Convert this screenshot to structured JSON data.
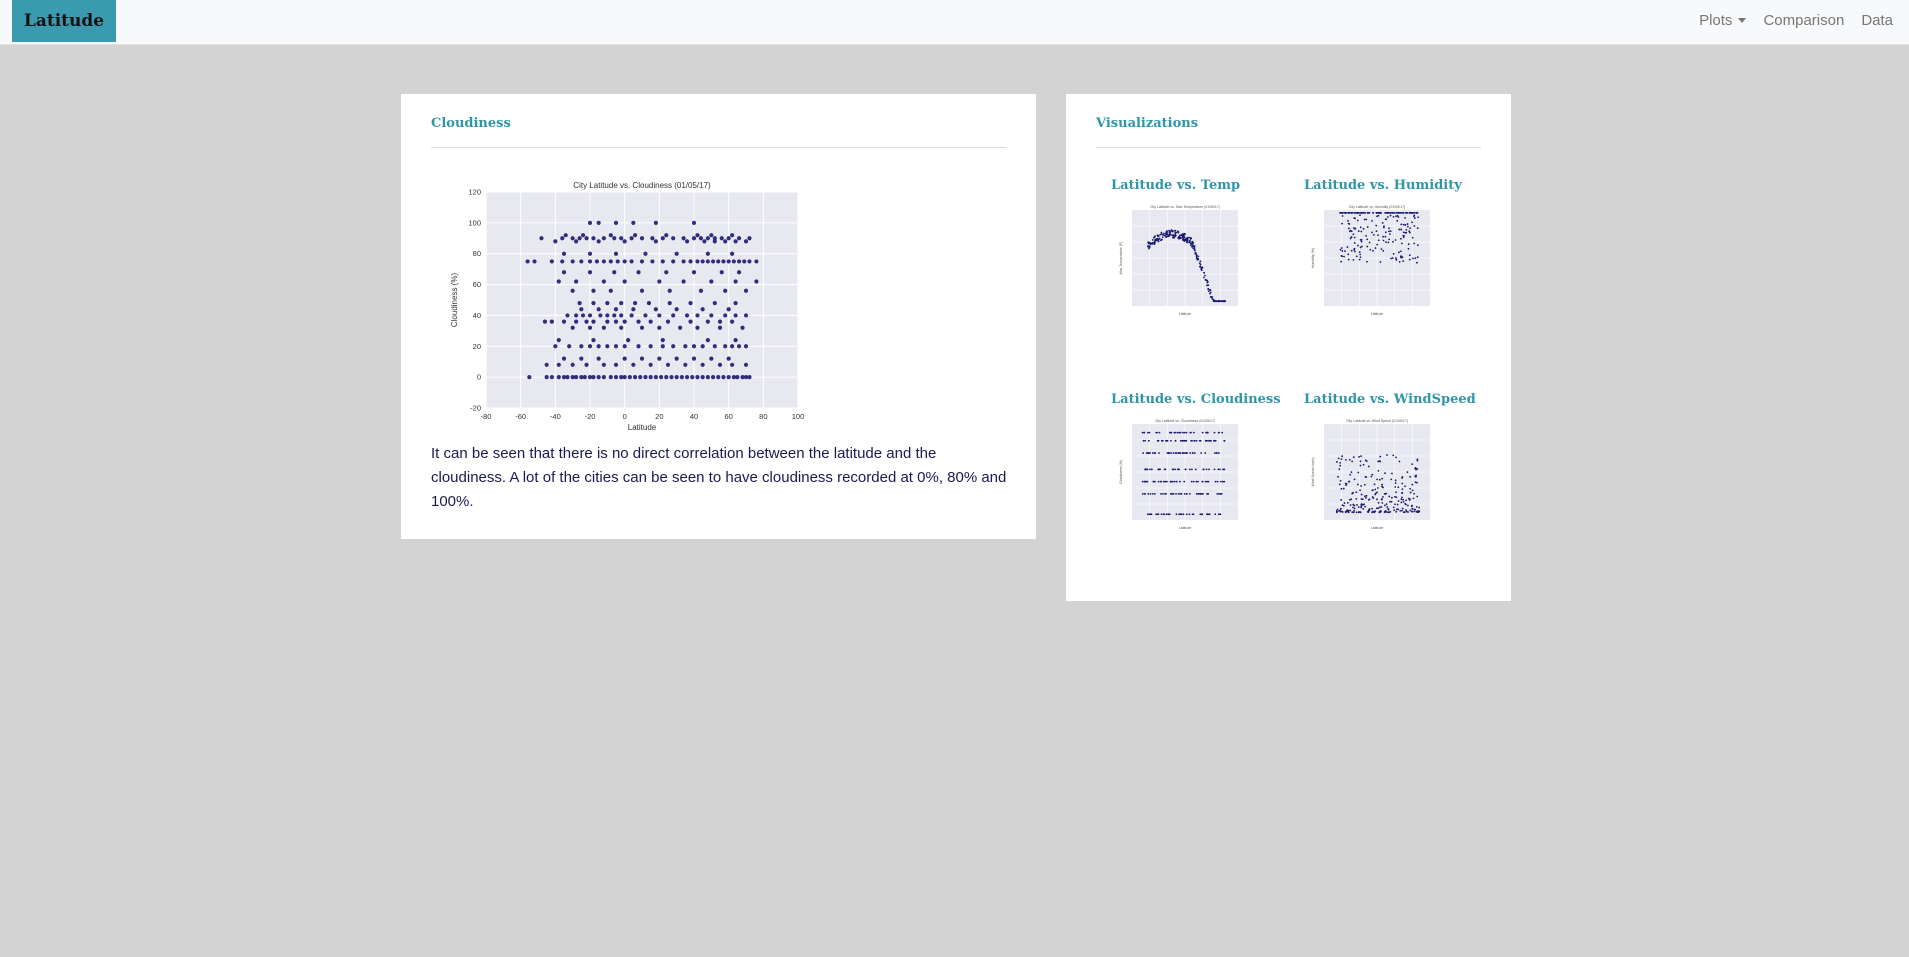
{
  "navbar": {
    "brand": "Latitude",
    "links": [
      {
        "label": "Plots",
        "dropdown": true
      },
      {
        "label": "Comparison"
      },
      {
        "label": "Data"
      }
    ]
  },
  "main_panel": {
    "title": "Cloudiness",
    "description": "It can be seen that there is no direct correlation between the latitude and the cloudiness. A lot of the cities can be seen to have cloudiness recorded at 0%, 80% and 100%."
  },
  "viz_panel": {
    "title": "Visualizations",
    "thumbnails": [
      {
        "title": "Latitude vs. Temp"
      },
      {
        "title": "Latitude vs. Humidity"
      },
      {
        "title": "Latitude vs. Cloudiness"
      },
      {
        "title": "Latitude vs. WindSpeed"
      }
    ]
  },
  "chart_data": {
    "type": "scatter",
    "title": "City Latitude vs. Cloudiness (01/05/17)",
    "xlabel": "Latitude",
    "ylabel": "Cloudiness (%)",
    "xlim": [
      -80,
      100
    ],
    "ylim": [
      -20,
      120
    ],
    "xticks": [
      -80,
      -60,
      -40,
      -20,
      0,
      20,
      40,
      60,
      80,
      100
    ],
    "yticks": [
      -20,
      0,
      20,
      40,
      60,
      80,
      100,
      120
    ],
    "grid": true,
    "point_color": "#191970",
    "background": "#e8e8f1",
    "points": [
      [
        -55,
        0
      ],
      [
        -45,
        0
      ],
      [
        -42,
        0
      ],
      [
        -38,
        0
      ],
      [
        -35,
        0
      ],
      [
        -33,
        0
      ],
      [
        -30,
        0
      ],
      [
        -28,
        0
      ],
      [
        -25,
        0
      ],
      [
        -23,
        0
      ],
      [
        -20,
        0
      ],
      [
        -18,
        0
      ],
      [
        -15,
        0
      ],
      [
        -12,
        0
      ],
      [
        -8,
        0
      ],
      [
        -5,
        0
      ],
      [
        -2,
        0
      ],
      [
        0,
        0
      ],
      [
        3,
        0
      ],
      [
        6,
        0
      ],
      [
        9,
        0
      ],
      [
        12,
        0
      ],
      [
        15,
        0
      ],
      [
        18,
        0
      ],
      [
        21,
        0
      ],
      [
        24,
        0
      ],
      [
        27,
        0
      ],
      [
        30,
        0
      ],
      [
        33,
        0
      ],
      [
        36,
        0
      ],
      [
        39,
        0
      ],
      [
        42,
        0
      ],
      [
        45,
        0
      ],
      [
        48,
        0
      ],
      [
        51,
        0
      ],
      [
        54,
        0
      ],
      [
        57,
        0
      ],
      [
        60,
        0
      ],
      [
        63,
        0
      ],
      [
        65,
        0
      ],
      [
        68,
        0
      ],
      [
        70,
        0
      ],
      [
        72,
        0
      ],
      [
        -45,
        8
      ],
      [
        -38,
        8
      ],
      [
        -30,
        8
      ],
      [
        -22,
        8
      ],
      [
        -12,
        8
      ],
      [
        -5,
        8
      ],
      [
        5,
        8
      ],
      [
        15,
        8
      ],
      [
        25,
        8
      ],
      [
        35,
        8
      ],
      [
        45,
        8
      ],
      [
        55,
        8
      ],
      [
        62,
        8
      ],
      [
        70,
        8
      ],
      [
        -35,
        12
      ],
      [
        -25,
        12
      ],
      [
        -15,
        12
      ],
      [
        0,
        12
      ],
      [
        10,
        12
      ],
      [
        20,
        12
      ],
      [
        30,
        12
      ],
      [
        40,
        12
      ],
      [
        50,
        12
      ],
      [
        60,
        12
      ],
      [
        -40,
        20
      ],
      [
        -32,
        20
      ],
      [
        -25,
        20
      ],
      [
        -20,
        20
      ],
      [
        -15,
        20
      ],
      [
        -10,
        20
      ],
      [
        -5,
        20
      ],
      [
        0,
        20
      ],
      [
        8,
        20
      ],
      [
        15,
        20
      ],
      [
        22,
        20
      ],
      [
        28,
        20
      ],
      [
        35,
        20
      ],
      [
        40,
        20
      ],
      [
        45,
        20
      ],
      [
        52,
        20
      ],
      [
        58,
        20
      ],
      [
        62,
        20
      ],
      [
        66,
        20
      ],
      [
        70,
        20
      ],
      [
        -38,
        24
      ],
      [
        -18,
        24
      ],
      [
        2,
        24
      ],
      [
        22,
        24
      ],
      [
        48,
        24
      ],
      [
        64,
        24
      ],
      [
        -30,
        32
      ],
      [
        -20,
        32
      ],
      [
        -12,
        32
      ],
      [
        -2,
        32
      ],
      [
        10,
        32
      ],
      [
        20,
        32
      ],
      [
        32,
        32
      ],
      [
        42,
        32
      ],
      [
        55,
        32
      ],
      [
        68,
        32
      ],
      [
        -46,
        36
      ],
      [
        -42,
        36
      ],
      [
        -35,
        36
      ],
      [
        -28,
        36
      ],
      [
        -22,
        36
      ],
      [
        -18,
        36
      ],
      [
        -10,
        36
      ],
      [
        -5,
        36
      ],
      [
        0,
        36
      ],
      [
        8,
        36
      ],
      [
        15,
        36
      ],
      [
        25,
        36
      ],
      [
        38,
        36
      ],
      [
        48,
        36
      ],
      [
        55,
        36
      ],
      [
        62,
        36
      ],
      [
        -33,
        40
      ],
      [
        -28,
        40
      ],
      [
        -24,
        40
      ],
      [
        -20,
        40
      ],
      [
        -14,
        40
      ],
      [
        -10,
        40
      ],
      [
        -6,
        40
      ],
      [
        -2,
        40
      ],
      [
        4,
        40
      ],
      [
        12,
        40
      ],
      [
        20,
        40
      ],
      [
        28,
        40
      ],
      [
        36,
        40
      ],
      [
        42,
        40
      ],
      [
        50,
        40
      ],
      [
        58,
        40
      ],
      [
        64,
        40
      ],
      [
        70,
        40
      ],
      [
        -25,
        44
      ],
      [
        -15,
        44
      ],
      [
        -5,
        44
      ],
      [
        5,
        44
      ],
      [
        18,
        44
      ],
      [
        30,
        44
      ],
      [
        45,
        44
      ],
      [
        60,
        44
      ],
      [
        -26,
        48
      ],
      [
        -18,
        48
      ],
      [
        -10,
        48
      ],
      [
        -2,
        48
      ],
      [
        6,
        48
      ],
      [
        14,
        48
      ],
      [
        26,
        48
      ],
      [
        38,
        48
      ],
      [
        52,
        48
      ],
      [
        64,
        48
      ],
      [
        -30,
        56
      ],
      [
        -18,
        56
      ],
      [
        -8,
        56
      ],
      [
        10,
        56
      ],
      [
        26,
        56
      ],
      [
        44,
        56
      ],
      [
        58,
        56
      ],
      [
        70,
        56
      ],
      [
        -38,
        62
      ],
      [
        -28,
        62
      ],
      [
        -12,
        62
      ],
      [
        0,
        62
      ],
      [
        20,
        62
      ],
      [
        34,
        62
      ],
      [
        50,
        62
      ],
      [
        64,
        62
      ],
      [
        76,
        62
      ],
      [
        -35,
        68
      ],
      [
        -20,
        68
      ],
      [
        -6,
        68
      ],
      [
        8,
        68
      ],
      [
        24,
        68
      ],
      [
        40,
        68
      ],
      [
        56,
        68
      ],
      [
        66,
        68
      ],
      [
        -56,
        75
      ],
      [
        -52,
        75
      ],
      [
        -42,
        75
      ],
      [
        -36,
        75
      ],
      [
        -30,
        75
      ],
      [
        -25,
        75
      ],
      [
        -20,
        75
      ],
      [
        -16,
        75
      ],
      [
        -12,
        75
      ],
      [
        -8,
        75
      ],
      [
        -4,
        75
      ],
      [
        0,
        75
      ],
      [
        4,
        75
      ],
      [
        10,
        75
      ],
      [
        16,
        75
      ],
      [
        22,
        75
      ],
      [
        28,
        75
      ],
      [
        34,
        75
      ],
      [
        38,
        75
      ],
      [
        42,
        75
      ],
      [
        45,
        75
      ],
      [
        48,
        75
      ],
      [
        51,
        75
      ],
      [
        54,
        75
      ],
      [
        57,
        75
      ],
      [
        60,
        75
      ],
      [
        63,
        75
      ],
      [
        66,
        75
      ],
      [
        69,
        75
      ],
      [
        72,
        75
      ],
      [
        76,
        75
      ],
      [
        -35,
        80
      ],
      [
        -20,
        80
      ],
      [
        -5,
        80
      ],
      [
        12,
        80
      ],
      [
        30,
        80
      ],
      [
        48,
        80
      ],
      [
        62,
        80
      ],
      [
        -40,
        88
      ],
      [
        -28,
        88
      ],
      [
        -15,
        88
      ],
      [
        0,
        88
      ],
      [
        18,
        88
      ],
      [
        36,
        88
      ],
      [
        46,
        88
      ],
      [
        52,
        88
      ],
      [
        58,
        88
      ],
      [
        64,
        88
      ],
      [
        70,
        88
      ],
      [
        -48,
        90
      ],
      [
        -36,
        90
      ],
      [
        -30,
        90
      ],
      [
        -26,
        90
      ],
      [
        -22,
        90
      ],
      [
        -18,
        90
      ],
      [
        -12,
        90
      ],
      [
        -6,
        90
      ],
      [
        -2,
        90
      ],
      [
        4,
        90
      ],
      [
        10,
        90
      ],
      [
        16,
        90
      ],
      [
        22,
        90
      ],
      [
        28,
        90
      ],
      [
        34,
        90
      ],
      [
        40,
        90
      ],
      [
        44,
        90
      ],
      [
        48,
        90
      ],
      [
        52,
        90
      ],
      [
        56,
        90
      ],
      [
        60,
        90
      ],
      [
        66,
        90
      ],
      [
        72,
        90
      ],
      [
        -34,
        92
      ],
      [
        -24,
        92
      ],
      [
        -8,
        92
      ],
      [
        6,
        92
      ],
      [
        24,
        92
      ],
      [
        42,
        92
      ],
      [
        50,
        92
      ],
      [
        62,
        92
      ],
      [
        -20,
        100
      ],
      [
        -15,
        100
      ],
      [
        -5,
        100
      ],
      [
        5,
        100
      ],
      [
        18,
        100
      ],
      [
        40,
        100
      ]
    ]
  },
  "thumb_data": [
    {
      "title": "City Latitude vs. Max Temperature (01/05/17)",
      "xlabel": "Latitude",
      "ylabel": "Max Temperature (F)"
    },
    {
      "title": "City Latitude vs. Humidity (01/05/17)",
      "xlabel": "Latitude",
      "ylabel": "Humidity (%)"
    },
    {
      "title": "City Latitude vs. Cloudiness (01/05/17)",
      "xlabel": "Latitude",
      "ylabel": "Cloudiness (%)"
    },
    {
      "title": "City Latitude vs. Wind Speed (01/05/17)",
      "xlabel": "Latitude",
      "ylabel": "Wind Speed (mph)"
    }
  ]
}
